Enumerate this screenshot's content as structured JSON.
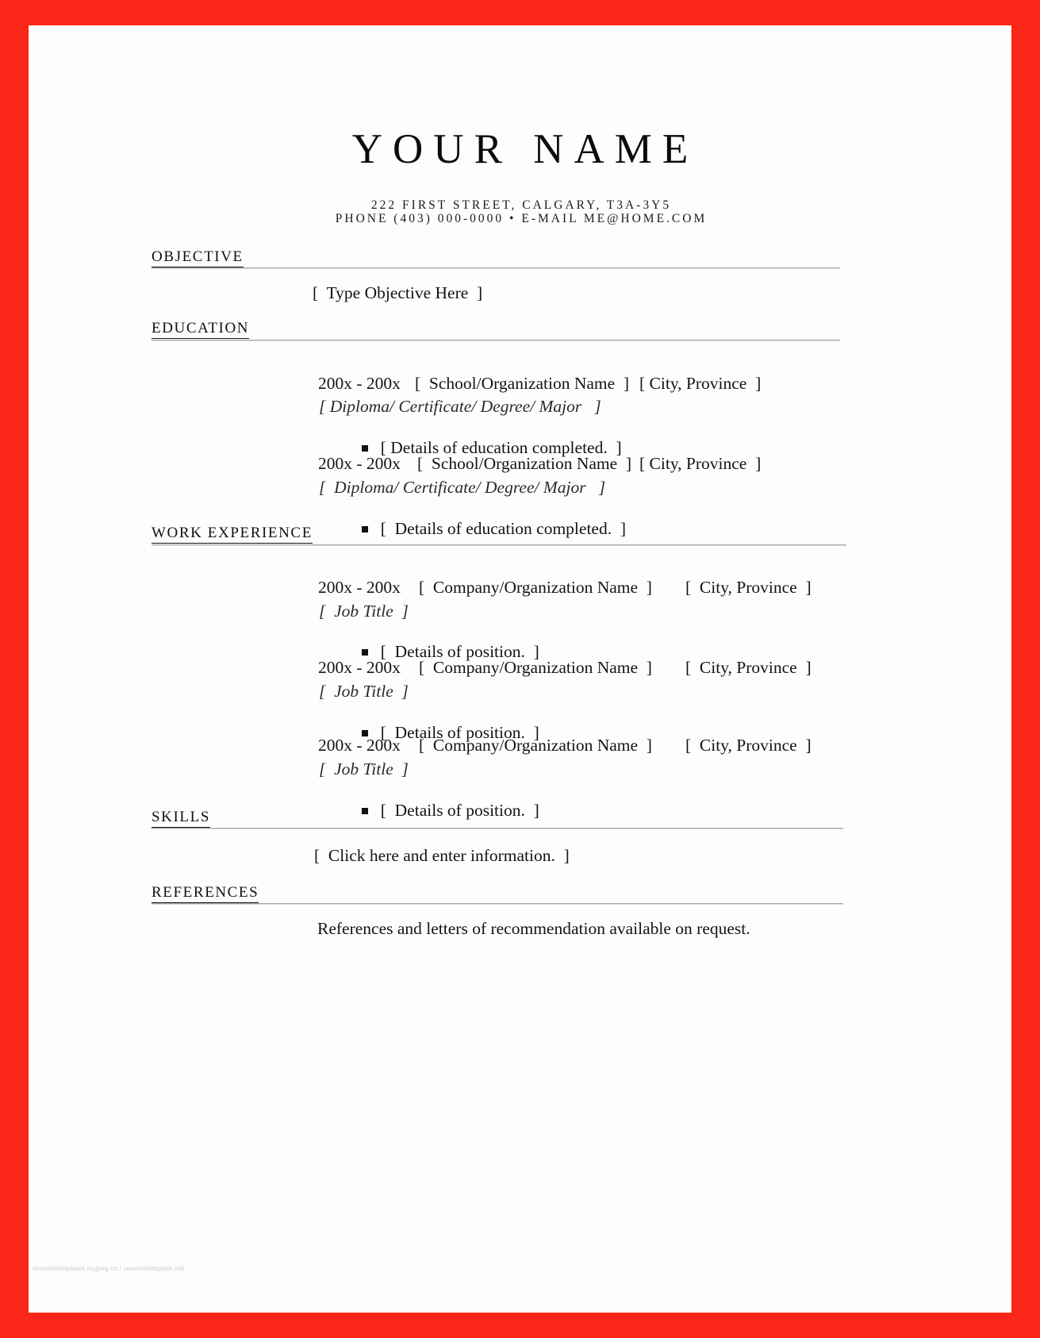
{
  "document": {
    "type": "resume-template",
    "frame_color": "#fb2718",
    "page_color": "#fdfdfd",
    "rule_color": "#a8a8ad"
  },
  "header": {
    "name": "YOUR NAME",
    "address_line": "222 FIRST STREET, CALGARY, T3A-3Y5",
    "contact_line": "PHONE (403) 000-0000 • E-MAIL ME@HOME.COM"
  },
  "sections": {
    "objective": {
      "heading": "OBJECTIVE",
      "body": "[  Type Objective Here  ]"
    },
    "education": {
      "heading": "EDUCATION",
      "entries": [
        {
          "dates": "200x - 200x",
          "organization": "[  School/Organization Name  ]",
          "location": "[ City, Province  ]",
          "subtitle": "[ Diploma/ Certificate/ Degree/ Major   ]",
          "detail": "[ Details of education completed.  ]"
        },
        {
          "dates": "200x - 200x",
          "organization": "[  School/Organization Name  ]",
          "location": "[ City, Province  ]",
          "subtitle": "[  Diploma/ Certificate/ Degree/ Major   ]",
          "detail": "[  Details of education completed.  ]"
        }
      ]
    },
    "work_experience": {
      "heading": "WORK EXPERIENCE",
      "entries": [
        {
          "dates": "200x - 200x",
          "organization": "[  Company/Organization Name  ]",
          "location": "[  City, Province  ]",
          "subtitle": "[  Job Title  ]",
          "detail": "[  Details of position.  ]"
        },
        {
          "dates": "200x - 200x",
          "organization": "[  Company/Organization Name  ]",
          "location": "[  City, Province  ]",
          "subtitle": "[  Job Title  ]",
          "detail": "[  Details of position.  ]"
        },
        {
          "dates": "200x - 200x",
          "organization": "[  Company/Organization Name  ]",
          "location": "[  City, Province  ]",
          "subtitle": "[  Job Title  ]",
          "detail": "[  Details of position.  ]"
        }
      ]
    },
    "skills": {
      "heading": "SKILLS",
      "body": "[  Click here and enter information.  ]"
    },
    "references": {
      "heading": "REFERENCES",
      "body": "References and letters of recommendation available on request."
    }
  },
  "watermark": {
    "text": "resumetemplates.myjpeg.co / resumetemplate.net"
  }
}
